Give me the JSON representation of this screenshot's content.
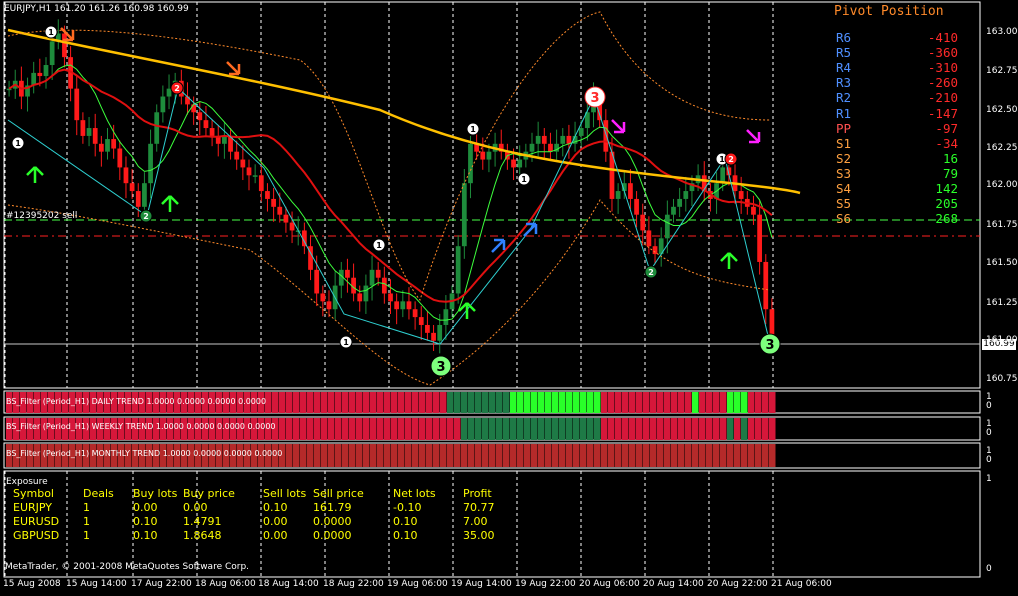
{
  "window": {
    "symbol_info": "EURJPY,H1  161.20 161.26 160.98 160.99",
    "order_label": "#12395202 sell",
    "current_price": "160.99"
  },
  "colors": {
    "background": "#000000",
    "bull": "#1e8c3c",
    "bear": "#ff1a1a",
    "ma_slow": "#ffc000",
    "ma_fast": "#e01010",
    "bands": "#ff8a2a",
    "zigzag": "#2ecfd0",
    "grid": "#ffffff"
  },
  "price_axis": {
    "ticks": [
      "163.00",
      "162.75",
      "162.50",
      "162.25",
      "162.00",
      "161.75",
      "161.50",
      "161.25",
      "161.00",
      "160.75"
    ],
    "min": 160.7,
    "max": 163.15
  },
  "time_axis": {
    "labels": [
      "15 Aug 2008",
      "15 Aug 14:00",
      "17 Aug 22:00",
      "18 Aug 06:00",
      "18 Aug 14:00",
      "18 Aug 22:00",
      "19 Aug 06:00",
      "19 Aug 14:00",
      "19 Aug 22:00",
      "20 Aug 06:00",
      "20 Aug 14:00",
      "20 Aug 22:00",
      "21 Aug 06:00"
    ]
  },
  "pivot": {
    "title": "Pivot Position",
    "levels": [
      {
        "name": "R6",
        "value": "-410",
        "name_color": "#4f8fff",
        "value_color": "#ff2a2a"
      },
      {
        "name": "R5",
        "value": "-360",
        "name_color": "#4f8fff",
        "value_color": "#ff2a2a"
      },
      {
        "name": "R4",
        "value": "-310",
        "name_color": "#4f8fff",
        "value_color": "#ff2a2a"
      },
      {
        "name": "R3",
        "value": "-260",
        "name_color": "#4f8fff",
        "value_color": "#ff2a2a"
      },
      {
        "name": "R2",
        "value": "-210",
        "name_color": "#4f8fff",
        "value_color": "#ff2a2a"
      },
      {
        "name": "R1",
        "value": "-147",
        "name_color": "#4f8fff",
        "value_color": "#ff2a2a"
      },
      {
        "name": "PP",
        "value": "-97",
        "name_color": "#ff5050",
        "value_color": "#ff2a2a"
      },
      {
        "name": "S1",
        "value": "-34",
        "name_color": "#ffa040",
        "value_color": "#ff2a2a"
      },
      {
        "name": "S2",
        "value": "16",
        "name_color": "#ffa040",
        "value_color": "#2aff2a"
      },
      {
        "name": "S3",
        "value": "79",
        "name_color": "#ffa040",
        "value_color": "#2aff2a"
      },
      {
        "name": "S4",
        "value": "142",
        "name_color": "#ffa040",
        "value_color": "#2aff2a"
      },
      {
        "name": "S5",
        "value": "205",
        "name_color": "#ffa040",
        "value_color": "#2aff2a"
      },
      {
        "name": "S6",
        "value": "268",
        "name_color": "#ffa040",
        "value_color": "#2aff2a"
      }
    ]
  },
  "indicators": [
    {
      "label": "BS_Filter (Period_H1) DAILY TREND 1.0000 0.0000 0.0000 0.0000",
      "axis_top": "1",
      "axis_bottom": "0"
    },
    {
      "label": "BS_Filter (Period_H1) WEEKLY TREND 1.0000 0.0000 0.0000 0.0000",
      "axis_top": "1",
      "axis_bottom": "0"
    },
    {
      "label": "BS_Filter (Period_H1) MONTHLY TREND 1.0000 0.0000 0.0000 0.0000",
      "axis_top": "1",
      "axis_bottom": "0"
    }
  ],
  "exposure": {
    "title": "Exposure",
    "axis_top": "1",
    "axis_bottom": "0",
    "columns": [
      "Symbol",
      "Deals",
      "Buy lots",
      "Buy price",
      "Sell lots",
      "Sell price",
      "Net lots",
      "Profit"
    ],
    "rows": [
      [
        "EURJPY",
        "1",
        "0.00",
        "0.00",
        "0.10",
        "161.79",
        "-0.10",
        "70.77"
      ],
      [
        "EURUSD",
        "1",
        "0.10",
        "1.4791",
        "0.00",
        "0.0000",
        "0.10",
        "7.00"
      ],
      [
        "GBPUSD",
        "1",
        "0.10",
        "1.8648",
        "0.00",
        "0.0000",
        "0.10",
        "35.00"
      ]
    ]
  },
  "copyright": "MetaTrader, © 2001-2008 MetaQuotes Software Corp.",
  "markers": {
    "circles": [
      {
        "label": "1",
        "bar": 7,
        "kind": "white"
      },
      {
        "label": "1",
        "bar": 0,
        "kind": "white"
      },
      {
        "label": "2",
        "bar": 21,
        "kind": "green"
      },
      {
        "label": "2",
        "bar": 26,
        "kind": "red"
      },
      {
        "label": "1",
        "bar": 52,
        "kind": "white"
      },
      {
        "label": "1",
        "bar": 59,
        "kind": "white"
      },
      {
        "label": "3",
        "bar": 69,
        "kind": "green_big"
      },
      {
        "label": "1",
        "bar": 74,
        "kind": "white"
      },
      {
        "label": "1",
        "bar": 82,
        "kind": "white"
      },
      {
        "label": "3",
        "bar": 95,
        "kind": "white_big"
      },
      {
        "label": "2",
        "bar": 104,
        "kind": "green"
      },
      {
        "label": "1",
        "bar": 115,
        "kind": "white"
      },
      {
        "label": "2",
        "bar": 116,
        "kind": "red"
      },
      {
        "label": "3",
        "bar": 123,
        "kind": "green_big"
      }
    ]
  }
}
